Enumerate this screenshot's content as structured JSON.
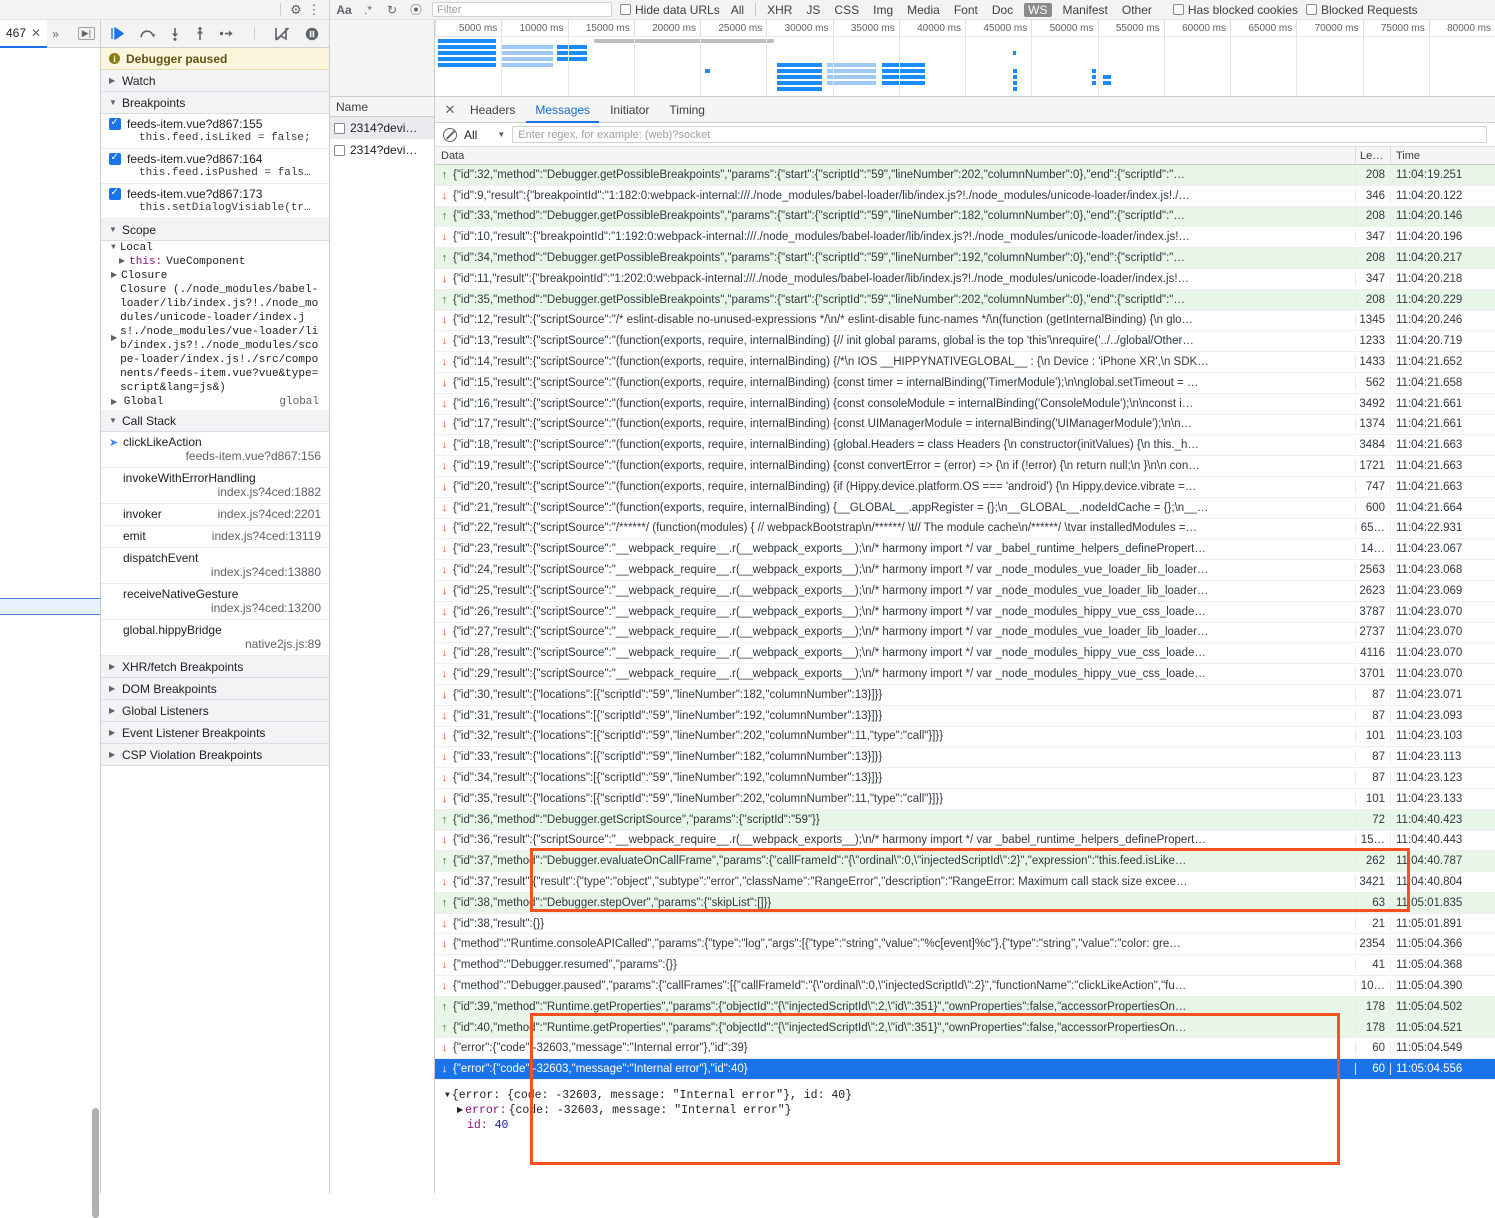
{
  "sources": {
    "tab_label": "467",
    "toolbar_icons": [
      "resume-icon",
      "step-over-icon",
      "step-into-icon",
      "step-out-icon",
      "step-icon",
      "deactivate-breakpoints-icon",
      "pause-on-exceptions-icon"
    ],
    "paused_banner": "Debugger paused",
    "sections": {
      "watch": "Watch",
      "breakpoints": "Breakpoints",
      "scope": "Scope",
      "call_stack": "Call Stack",
      "xhr_breakpoints": "XHR/fetch Breakpoints",
      "dom_breakpoints": "DOM Breakpoints",
      "global_listeners": "Global Listeners",
      "event_listener_breakpoints": "Event Listener Breakpoints",
      "csp_violation_breakpoints": "CSP Violation Breakpoints"
    },
    "breakpoints": [
      {
        "checked": true,
        "location": "feeds-item.vue?d867:155",
        "code": "this.feed.isLiked = false;"
      },
      {
        "checked": true,
        "location": "feeds-item.vue?d867:164",
        "code": "this.feed.isPushed = fals…"
      },
      {
        "checked": true,
        "location": "feeds-item.vue?d867:173",
        "code": "this.setDialogVisiable(tr…"
      }
    ],
    "scope": {
      "local_label": "Local",
      "this_label": "this:",
      "this_value": "VueComponent",
      "closure_label": "Closure",
      "closure_long": "Closure (./node_modules/babel-loader/lib/index.js?!./node_modules/unicode-loader/index.js!./node_modules/vue-loader/lib/index.js?!./node_modules/scope-loader/index.js!./src/components/feeds-item.vue?vue&type=script&lang=js&)",
      "global_label": "Global",
      "global_value": "global"
    },
    "call_stack": [
      {
        "fn": "clickLikeAction",
        "loc": "feeds-item.vue?d867:156",
        "selected": true
      },
      {
        "fn": "invokeWithErrorHandling",
        "loc": "index.js?4ced:1882",
        "selected": false
      },
      {
        "fn": "invoker",
        "loc": "index.js?4ced:2201",
        "selected": false
      },
      {
        "fn": "emit",
        "loc": "index.js?4ced:13119",
        "selected": false
      },
      {
        "fn": "dispatchEvent",
        "loc": "index.js?4ced:13880",
        "selected": false
      },
      {
        "fn": "receiveNativeGesture",
        "loc": "index.js?4ced:13200",
        "selected": false
      },
      {
        "fn": "global.hippyBridge",
        "loc": "native2js.js:89",
        "selected": false
      }
    ]
  },
  "network": {
    "filter_placeholder": "Filter",
    "hide_data_urls": "Hide data URLs",
    "resource_types": [
      "All",
      "XHR",
      "JS",
      "CSS",
      "Img",
      "Media",
      "Font",
      "Doc",
      "WS",
      "Manifest",
      "Other"
    ],
    "active_type": "WS",
    "has_blocked_cookies": "Has blocked cookies",
    "blocked_requests": "Blocked Requests",
    "overview_ticks": [
      "5000 ms",
      "10000 ms",
      "15000 ms",
      "20000 ms",
      "25000 ms",
      "30000 ms",
      "35000 ms",
      "40000 ms",
      "45000 ms",
      "50000 ms",
      "55000 ms",
      "60000 ms",
      "65000 ms",
      "70000 ms",
      "75000 ms",
      "80000 ms"
    ],
    "requests_header": "Name",
    "requests": [
      {
        "name": "2314?devi…",
        "selected": true
      },
      {
        "name": "2314?devi…",
        "selected": false
      }
    ],
    "detail_tabs": [
      "Headers",
      "Messages",
      "Initiator",
      "Timing"
    ],
    "active_detail_tab": "Messages",
    "message_filter_select": "All",
    "message_filter_placeholder": "Enter regex, for example: (web)?socket",
    "columns": {
      "data": "Data",
      "length": "Le…",
      "time": "Time"
    }
  },
  "messages": [
    {
      "dir": "up",
      "text": "{\"id\":32,\"method\":\"Debugger.getPossibleBreakpoints\",\"params\":{\"start\":{\"scriptId\":\"59\",\"lineNumber\":202,\"columnNumber\":0},\"end\":{\"scriptId\":\"…",
      "len": "208",
      "time": "11:04:19.251"
    },
    {
      "dir": "down",
      "text": "{\"id\":9,\"result\":{\"breakpointId\":\"1:182:0:webpack-internal:///./node_modules/babel-loader/lib/index.js?!./node_modules/unicode-loader/index.js!./…",
      "len": "346",
      "time": "11:04:20.122"
    },
    {
      "dir": "up",
      "text": "{\"id\":33,\"method\":\"Debugger.getPossibleBreakpoints\",\"params\":{\"start\":{\"scriptId\":\"59\",\"lineNumber\":182,\"columnNumber\":0},\"end\":{\"scriptId\":\"…",
      "len": "208",
      "time": "11:04:20.146"
    },
    {
      "dir": "down",
      "text": "{\"id\":10,\"result\":{\"breakpointId\":\"1:192:0:webpack-internal:///./node_modules/babel-loader/lib/index.js?!./node_modules/unicode-loader/index.js!…",
      "len": "347",
      "time": "11:04:20.196"
    },
    {
      "dir": "up",
      "text": "{\"id\":34,\"method\":\"Debugger.getPossibleBreakpoints\",\"params\":{\"start\":{\"scriptId\":\"59\",\"lineNumber\":192,\"columnNumber\":0},\"end\":{\"scriptId\":\"…",
      "len": "208",
      "time": "11:04:20.217"
    },
    {
      "dir": "down",
      "text": "{\"id\":11,\"result\":{\"breakpointId\":\"1:202:0:webpack-internal:///./node_modules/babel-loader/lib/index.js?!./node_modules/unicode-loader/index.js!…",
      "len": "347",
      "time": "11:04:20.218"
    },
    {
      "dir": "up",
      "text": "{\"id\":35,\"method\":\"Debugger.getPossibleBreakpoints\",\"params\":{\"start\":{\"scriptId\":\"59\",\"lineNumber\":202,\"columnNumber\":0},\"end\":{\"scriptId\":\"…",
      "len": "208",
      "time": "11:04:20.229"
    },
    {
      "dir": "down",
      "text": "{\"id\":12,\"result\":{\"scriptSource\":\"/* eslint-disable no-unused-expressions */\\n/* eslint-disable func-names */\\n(function (getInternalBinding) {\\n glo…",
      "len": "1345",
      "time": "11:04:20.246"
    },
    {
      "dir": "down",
      "text": "{\"id\":13,\"result\":{\"scriptSource\":\"(function(exports, require, internalBinding) {// init global params, global is the top 'this'\\nrequire('../../global/Other…",
      "len": "1233",
      "time": "11:04:20.719"
    },
    {
      "dir": "down",
      "text": "{\"id\":14,\"result\":{\"scriptSource\":\"(function(exports, require, internalBinding) {/*\\n IOS __HIPPYNATIVEGLOBAL__ : {\\n Device : 'iPhone XR',\\n SDK…",
      "len": "1433",
      "time": "11:04:21.652"
    },
    {
      "dir": "down",
      "text": "{\"id\":15,\"result\":{\"scriptSource\":\"(function(exports, require, internalBinding) {const timer = internalBinding('TimerModule');\\n\\nglobal.setTimeout = …",
      "len": "562",
      "time": "11:04:21.658"
    },
    {
      "dir": "down",
      "text": "{\"id\":16,\"result\":{\"scriptSource\":\"(function(exports, require, internalBinding) {const consoleModule = internalBinding('ConsoleModule');\\n\\nconst i…",
      "len": "3492",
      "time": "11:04:21.661"
    },
    {
      "dir": "down",
      "text": "{\"id\":17,\"result\":{\"scriptSource\":\"(function(exports, require, internalBinding) {const UIManagerModule = internalBinding('UIManagerModule');\\n\\n…",
      "len": "1374",
      "time": "11:04:21.661"
    },
    {
      "dir": "down",
      "text": "{\"id\":18,\"result\":{\"scriptSource\":\"(function(exports, require, internalBinding) {global.Headers = class Headers {\\n constructor(initValues) {\\n this._h…",
      "len": "3484",
      "time": "11:04:21.663"
    },
    {
      "dir": "down",
      "text": "{\"id\":19,\"result\":{\"scriptSource\":\"(function(exports, require, internalBinding) {const convertError = (error) => {\\n if (!error) {\\n return null;\\n }\\n\\n con…",
      "len": "1721",
      "time": "11:04:21.663"
    },
    {
      "dir": "down",
      "text": "{\"id\":20,\"result\":{\"scriptSource\":\"(function(exports, require, internalBinding) {if (Hippy.device.platform.OS === 'android') {\\n Hippy.device.vibrate =…",
      "len": "747",
      "time": "11:04:21.663"
    },
    {
      "dir": "down",
      "text": "{\"id\":21,\"result\":{\"scriptSource\":\"(function(exports, require, internalBinding) {__GLOBAL__.appRegister = {};\\n__GLOBAL__.nodeIdCache = {};\\n__…",
      "len": "600",
      "time": "11:04:21.664"
    },
    {
      "dir": "down",
      "text": "{\"id\":22,\"result\":{\"scriptSource\":\"/******/ (function(modules) { // webpackBootstrap\\n/******/ \\t// The module cache\\n/******/ \\tvar installedModules =…",
      "len": "65…",
      "time": "11:04:22.931"
    },
    {
      "dir": "down",
      "text": "{\"id\":23,\"result\":{\"scriptSource\":\"__webpack_require__.r(__webpack_exports__);\\n/* harmony import */ var _babel_runtime_helpers_definePropert…",
      "len": "14…",
      "time": "11:04:23.067"
    },
    {
      "dir": "down",
      "text": "{\"id\":24,\"result\":{\"scriptSource\":\"__webpack_require__.r(__webpack_exports__);\\n/* harmony import */ var _node_modules_vue_loader_lib_loader…",
      "len": "2563",
      "time": "11:04:23.068"
    },
    {
      "dir": "down",
      "text": "{\"id\":25,\"result\":{\"scriptSource\":\"__webpack_require__.r(__webpack_exports__);\\n/* harmony import */ var _node_modules_vue_loader_lib_loader…",
      "len": "2623",
      "time": "11:04:23.069"
    },
    {
      "dir": "down",
      "text": "{\"id\":26,\"result\":{\"scriptSource\":\"__webpack_require__.r(__webpack_exports__);\\n/* harmony import */ var _node_modules_hippy_vue_css_loade…",
      "len": "3787",
      "time": "11:04:23.070"
    },
    {
      "dir": "down",
      "text": "{\"id\":27,\"result\":{\"scriptSource\":\"__webpack_require__.r(__webpack_exports__);\\n/* harmony import */ var _node_modules_vue_loader_lib_loader…",
      "len": "2737",
      "time": "11:04:23.070"
    },
    {
      "dir": "down",
      "text": "{\"id\":28,\"result\":{\"scriptSource\":\"__webpack_require__.r(__webpack_exports__);\\n/* harmony import */ var _node_modules_hippy_vue_css_loade…",
      "len": "4116",
      "time": "11:04:23.070"
    },
    {
      "dir": "down",
      "text": "{\"id\":29,\"result\":{\"scriptSource\":\"__webpack_require__.r(__webpack_exports__);\\n/* harmony import */ var _node_modules_hippy_vue_css_loade…",
      "len": "3701",
      "time": "11:04:23.070"
    },
    {
      "dir": "down",
      "text": "{\"id\":30,\"result\":{\"locations\":[{\"scriptId\":\"59\",\"lineNumber\":182,\"columnNumber\":13}]}}",
      "len": "87",
      "time": "11:04:23.071"
    },
    {
      "dir": "down",
      "text": "{\"id\":31,\"result\":{\"locations\":[{\"scriptId\":\"59\",\"lineNumber\":192,\"columnNumber\":13}]}}",
      "len": "87",
      "time": "11:04:23.093"
    },
    {
      "dir": "down",
      "text": "{\"id\":32,\"result\":{\"locations\":[{\"scriptId\":\"59\",\"lineNumber\":202,\"columnNumber\":11,\"type\":\"call\"}]}}",
      "len": "101",
      "time": "11:04:23.103"
    },
    {
      "dir": "down",
      "text": "{\"id\":33,\"result\":{\"locations\":[{\"scriptId\":\"59\",\"lineNumber\":182,\"columnNumber\":13}]}}",
      "len": "87",
      "time": "11:04:23.113"
    },
    {
      "dir": "down",
      "text": "{\"id\":34,\"result\":{\"locations\":[{\"scriptId\":\"59\",\"lineNumber\":192,\"columnNumber\":13}]}}",
      "len": "87",
      "time": "11:04:23.123"
    },
    {
      "dir": "down",
      "text": "{\"id\":35,\"result\":{\"locations\":[{\"scriptId\":\"59\",\"lineNumber\":202,\"columnNumber\":11,\"type\":\"call\"}]}}",
      "len": "101",
      "time": "11:04:23.133"
    },
    {
      "dir": "up",
      "text": "{\"id\":36,\"method\":\"Debugger.getScriptSource\",\"params\":{\"scriptId\":\"59\"}}",
      "len": "72",
      "time": "11:04:40.423"
    },
    {
      "dir": "down",
      "text": "{\"id\":36,\"result\":{\"scriptSource\":\"__webpack_require__.r(__webpack_exports__);\\n/* harmony import */ var _babel_runtime_helpers_definePropert…",
      "len": "15…",
      "time": "11:04:40.443"
    },
    {
      "dir": "up",
      "text": "{\"id\":37,\"method\":\"Debugger.evaluateOnCallFrame\",\"params\":{\"callFrameId\":\"{\\\"ordinal\\\":0,\\\"injectedScriptId\\\":2}\",\"expression\":\"this.feed.isLike…",
      "len": "262",
      "time": "11:04:40.787"
    },
    {
      "dir": "down",
      "text": "{\"id\":37,\"result\":{\"result\":{\"type\":\"object\",\"subtype\":\"error\",\"className\":\"RangeError\",\"description\":\"RangeError: Maximum call stack size excee…",
      "len": "3421",
      "time": "11:04:40.804"
    },
    {
      "dir": "up",
      "text": "{\"id\":38,\"method\":\"Debugger.stepOver\",\"params\":{\"skipList\":[]}}",
      "len": "63",
      "time": "11:05:01.835"
    },
    {
      "dir": "down",
      "text": "{\"id\":38,\"result\":{}}",
      "len": "21",
      "time": "11:05:01.891"
    },
    {
      "dir": "down",
      "text": "{\"method\":\"Runtime.consoleAPICalled\",\"params\":{\"type\":\"log\",\"args\":[{\"type\":\"string\",\"value\":\"%c[event]%c\"},{\"type\":\"string\",\"value\":\"color: gre…",
      "len": "2354",
      "time": "11:05:04.366"
    },
    {
      "dir": "down",
      "text": "{\"method\":\"Debugger.resumed\",\"params\":{}}",
      "len": "41",
      "time": "11:05:04.368"
    },
    {
      "dir": "down",
      "text": "{\"method\":\"Debugger.paused\",\"params\":{\"callFrames\":[{\"callFrameId\":\"{\\\"ordinal\\\":0,\\\"injectedScriptId\\\":2}\",\"functionName\":\"clickLikeAction\",\"fu…",
      "len": "10…",
      "time": "11:05:04.390"
    },
    {
      "dir": "up",
      "text": "{\"id\":39,\"method\":\"Runtime.getProperties\",\"params\":{\"objectId\":\"{\\\"injectedScriptId\\\":2,\\\"id\\\":351}\",\"ownProperties\":false,\"accessorPropertiesOn…",
      "len": "178",
      "time": "11:05:04.502"
    },
    {
      "dir": "up",
      "text": "{\"id\":40,\"method\":\"Runtime.getProperties\",\"params\":{\"objectId\":\"{\\\"injectedScriptId\\\":2,\\\"id\\\":351}\",\"ownProperties\":false,\"accessorPropertiesOn…",
      "len": "178",
      "time": "11:05:04.521"
    },
    {
      "dir": "down",
      "text": "{\"error\":{\"code\":-32603,\"message\":\"Internal error\"},\"id\":39}",
      "len": "60",
      "time": "11:05:04.549"
    },
    {
      "dir": "down",
      "text": "{\"error\":{\"code\":-32603,\"message\":\"Internal error\"},\"id\":40}",
      "len": "60",
      "time": "11:05:04.556",
      "selected": true
    }
  ],
  "message_detail": {
    "line1_prefix": "{error: ",
    "line1": "{error: {code: -32603, message: \"Internal error\"}, id: 40}",
    "line2_key": "error:",
    "line2_val": " {code: -32603, message: \"Internal error\"}",
    "line3_key": "id:",
    "line3_val": "40"
  },
  "annotations": {
    "accent_color": "#f4511e",
    "box1": "evaluateOnCallFrame RangeError highlight",
    "box2": "Runtime.getProperties internal error highlight"
  }
}
